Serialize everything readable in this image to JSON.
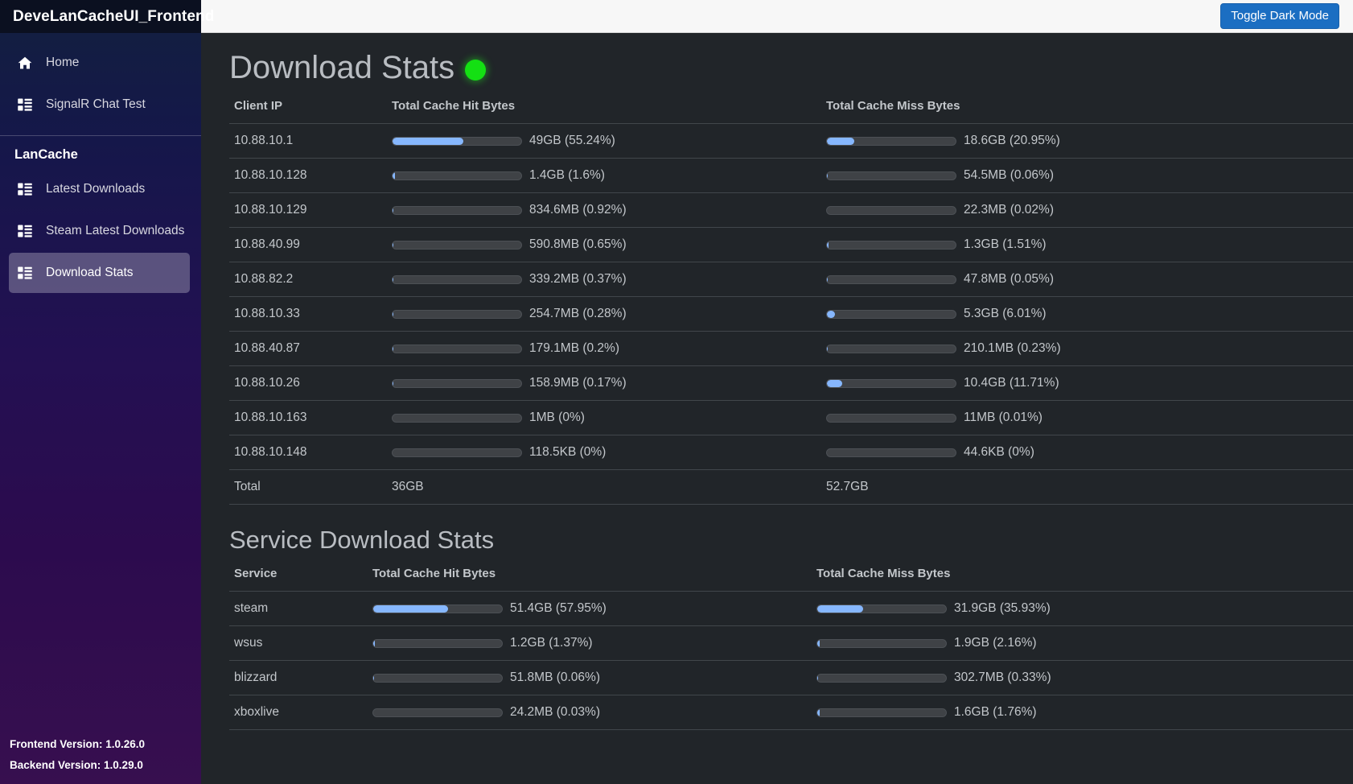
{
  "brand": {
    "title": "DeveLanCacheUI_Frontend"
  },
  "topbar": {
    "toggle_label": "Toggle Dark Mode"
  },
  "sidebar": {
    "top_items": [
      {
        "label": "Home",
        "icon": "home-icon",
        "active": false
      },
      {
        "label": "SignalR Chat Test",
        "icon": "list-icon",
        "active": false
      }
    ],
    "group_title": "LanCache",
    "group_items": [
      {
        "label": "Latest Downloads",
        "icon": "list-icon",
        "active": false
      },
      {
        "label": "Steam Latest Downloads",
        "icon": "list-icon",
        "active": false
      },
      {
        "label": "Download Stats",
        "icon": "list-icon",
        "active": true
      }
    ],
    "footer": {
      "frontend_version": "Frontend Version: 1.0.26.0",
      "backend_version": "Backend Version: 1.0.29.0"
    }
  },
  "colors": {
    "accent_blue": "#1b6ec2",
    "bar_fill": "#86b7fe",
    "bar_track": "#3f4246",
    "status_green": "#14e013",
    "page_bg": "#212529"
  },
  "client_stats": {
    "title": "Download Stats",
    "status": "online",
    "columns": [
      "Client IP",
      "Total Cache Hit Bytes",
      "Total Cache Miss Bytes"
    ],
    "rows": [
      {
        "ip": "10.88.10.1",
        "hit_text": "49GB (55.24%)",
        "hit_pct": 55.24,
        "miss_text": "18.6GB (20.95%)",
        "miss_pct": 20.95
      },
      {
        "ip": "10.88.10.128",
        "hit_text": "1.4GB (1.6%)",
        "hit_pct": 1.6,
        "miss_text": "54.5MB (0.06%)",
        "miss_pct": 0.06
      },
      {
        "ip": "10.88.10.129",
        "hit_text": "834.6MB (0.92%)",
        "hit_pct": 0.92,
        "miss_text": "22.3MB (0.02%)",
        "miss_pct": 0.02
      },
      {
        "ip": "10.88.40.99",
        "hit_text": "590.8MB (0.65%)",
        "hit_pct": 0.65,
        "miss_text": "1.3GB (1.51%)",
        "miss_pct": 1.51
      },
      {
        "ip": "10.88.82.2",
        "hit_text": "339.2MB (0.37%)",
        "hit_pct": 0.37,
        "miss_text": "47.8MB (0.05%)",
        "miss_pct": 0.05
      },
      {
        "ip": "10.88.10.33",
        "hit_text": "254.7MB (0.28%)",
        "hit_pct": 0.28,
        "miss_text": "5.3GB (6.01%)",
        "miss_pct": 6.01
      },
      {
        "ip": "10.88.40.87",
        "hit_text": "179.1MB (0.2%)",
        "hit_pct": 0.2,
        "miss_text": "210.1MB (0.23%)",
        "miss_pct": 0.23
      },
      {
        "ip": "10.88.10.26",
        "hit_text": "158.9MB (0.17%)",
        "hit_pct": 0.17,
        "miss_text": "10.4GB (11.71%)",
        "miss_pct": 11.71
      },
      {
        "ip": "10.88.10.163",
        "hit_text": "1MB (0%)",
        "hit_pct": 0,
        "miss_text": "11MB (0.01%)",
        "miss_pct": 0.01
      },
      {
        "ip": "10.88.10.148",
        "hit_text": "118.5KB (0%)",
        "hit_pct": 0,
        "miss_text": "44.6KB (0%)",
        "miss_pct": 0
      }
    ],
    "total": {
      "label": "Total",
      "hit": "36GB",
      "miss": "52.7GB"
    }
  },
  "service_stats": {
    "title": "Service Download Stats",
    "columns": [
      "Service",
      "Total Cache Hit Bytes",
      "Total Cache Miss Bytes"
    ],
    "rows": [
      {
        "service": "steam",
        "hit_text": "51.4GB (57.95%)",
        "hit_pct": 57.95,
        "miss_text": "31.9GB (35.93%)",
        "miss_pct": 35.93
      },
      {
        "service": "wsus",
        "hit_text": "1.2GB (1.37%)",
        "hit_pct": 1.37,
        "miss_text": "1.9GB (2.16%)",
        "miss_pct": 2.16
      },
      {
        "service": "blizzard",
        "hit_text": "51.8MB (0.06%)",
        "hit_pct": 0.06,
        "miss_text": "302.7MB (0.33%)",
        "miss_pct": 0.33
      },
      {
        "service": "xboxlive",
        "hit_text": "24.2MB (0.03%)",
        "hit_pct": 0.03,
        "miss_text": "1.6GB (1.76%)",
        "miss_pct": 1.76
      }
    ]
  }
}
